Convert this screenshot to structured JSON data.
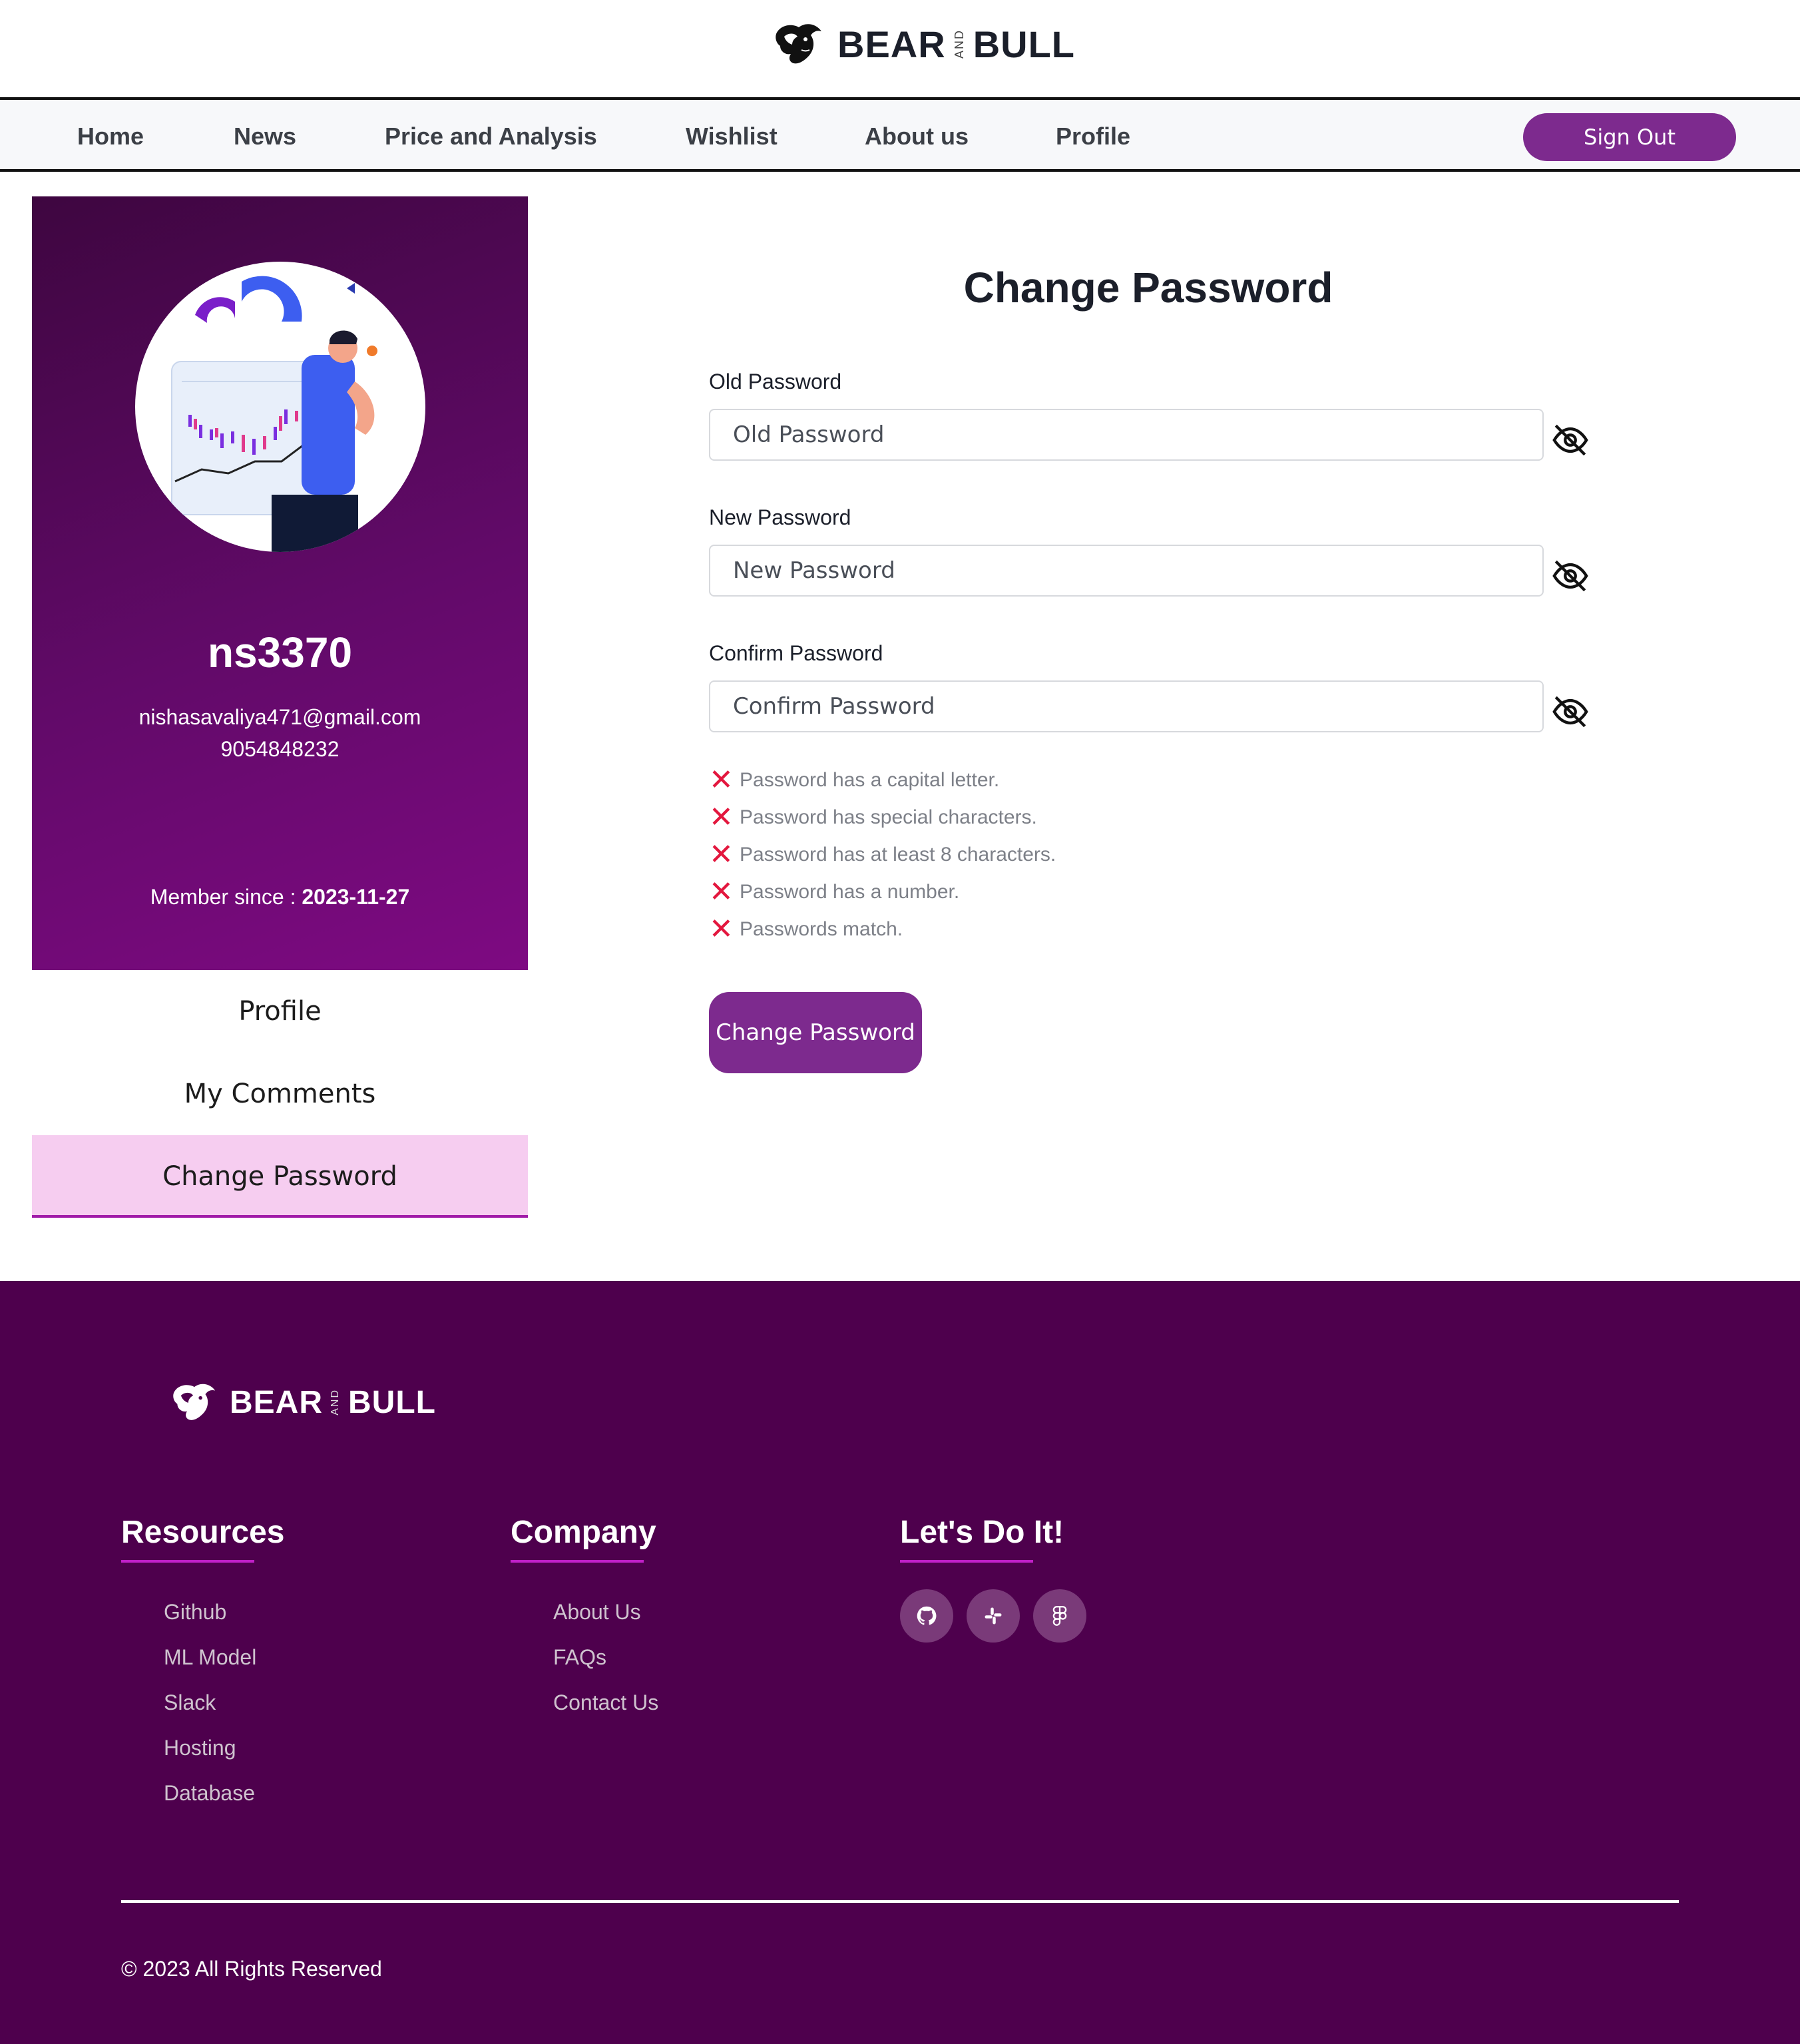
{
  "brand": {
    "left": "BEAR",
    "middle": "AND",
    "right": "BULL"
  },
  "nav": {
    "items": [
      "Home",
      "News",
      "Price and Analysis",
      "Wishlist",
      "About us",
      "Profile"
    ],
    "sign_out": "Sign Out"
  },
  "profile": {
    "username": "ns3370",
    "email": "nishasavaliya471@gmail.com",
    "phone": "9054848232",
    "member_label": "Member since : ",
    "member_date": "2023-11-27"
  },
  "side_menu": {
    "items": [
      "Profile",
      "My Comments",
      "Change Password"
    ],
    "active": "Change Password"
  },
  "form": {
    "title": "Change Password",
    "old": {
      "label": "Old Password",
      "placeholder": "Old Password"
    },
    "new": {
      "label": "New Password",
      "placeholder": "New Password"
    },
    "confirm": {
      "label": "Confirm Password",
      "placeholder": "Confirm Password"
    },
    "rules": [
      "Password has a capital letter.",
      "Password has special characters.",
      "Password has at least 8 characters.",
      "Password has a number.",
      "Passwords match."
    ],
    "rule_mark": "✕",
    "submit": "Change Password"
  },
  "footer": {
    "resources": {
      "heading": "Resources",
      "links": [
        "Github",
        "ML Model",
        "Slack",
        "Hosting",
        "Database"
      ]
    },
    "company": {
      "heading": "Company",
      "links": [
        "About Us",
        "FAQs",
        "Contact Us"
      ]
    },
    "social": {
      "heading": "Let's Do It!",
      "icons": [
        "github-icon",
        "slack-icon",
        "figma-icon"
      ]
    },
    "copyright": "© 2023 All Rights Reserved"
  },
  "colors": {
    "accent": "#7d2a8e",
    "footer_bg": "#4e004d",
    "card_gradient_start": "#3e0640",
    "card_gradient_end": "#7e0a82",
    "active_tab_bg": "#f6cdf0",
    "error": "#e3173e"
  }
}
